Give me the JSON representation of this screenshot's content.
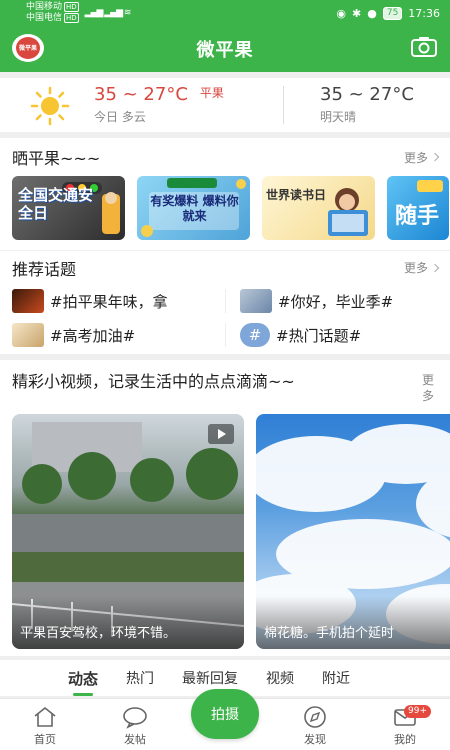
{
  "status_bar": {
    "carrier1": "中国移动",
    "carrier2": "中国电信",
    "hd_tag": "HD",
    "network": "4G",
    "battery": "75",
    "time": "17:36"
  },
  "header": {
    "title": "微平果",
    "logo_text": "微平果"
  },
  "weather": {
    "today_temp": "35 ~ 27°C",
    "city": "平果",
    "today_desc": "今日 多云",
    "tomorrow_temp": "35 ~ 27°C",
    "tomorrow_desc": "明天晴"
  },
  "photos": {
    "title": "晒平果~~~",
    "more": "更多",
    "banners": [
      {
        "text": "全国交通安全日",
        "icon": "traffic-light-image"
      },
      {
        "text": "有奖爆料 爆料你就来",
        "icon": "prize-image"
      },
      {
        "text": "世界读书日",
        "icon": "reading-image"
      },
      {
        "text": "随手",
        "icon": "camera-image"
      }
    ]
  },
  "topics": {
    "title": "推荐话题",
    "more": "更多",
    "items": [
      {
        "label": "#拍平果年味，拿"
      },
      {
        "label": "#你好，毕业季#"
      },
      {
        "label": "#高考加油#"
      },
      {
        "label": "#热门话题#"
      }
    ]
  },
  "videos": {
    "title": "精彩小视频，记录生活中的点点滴滴~~",
    "more": "更多",
    "items": [
      {
        "caption": "平果百安驾校，环境不错。"
      },
      {
        "caption": "棉花糖。手机拍个延时"
      }
    ]
  },
  "tabs": [
    "动态",
    "热门",
    "最新回复",
    "视频",
    "附近"
  ],
  "bottom_nav": {
    "home": "首页",
    "post": "发帖",
    "shoot": "拍摄",
    "discover": "发现",
    "mine": "我的",
    "badge": "99+"
  },
  "colors": {
    "brand_green": "#3cb44a",
    "temp_red": "#d9473f"
  }
}
